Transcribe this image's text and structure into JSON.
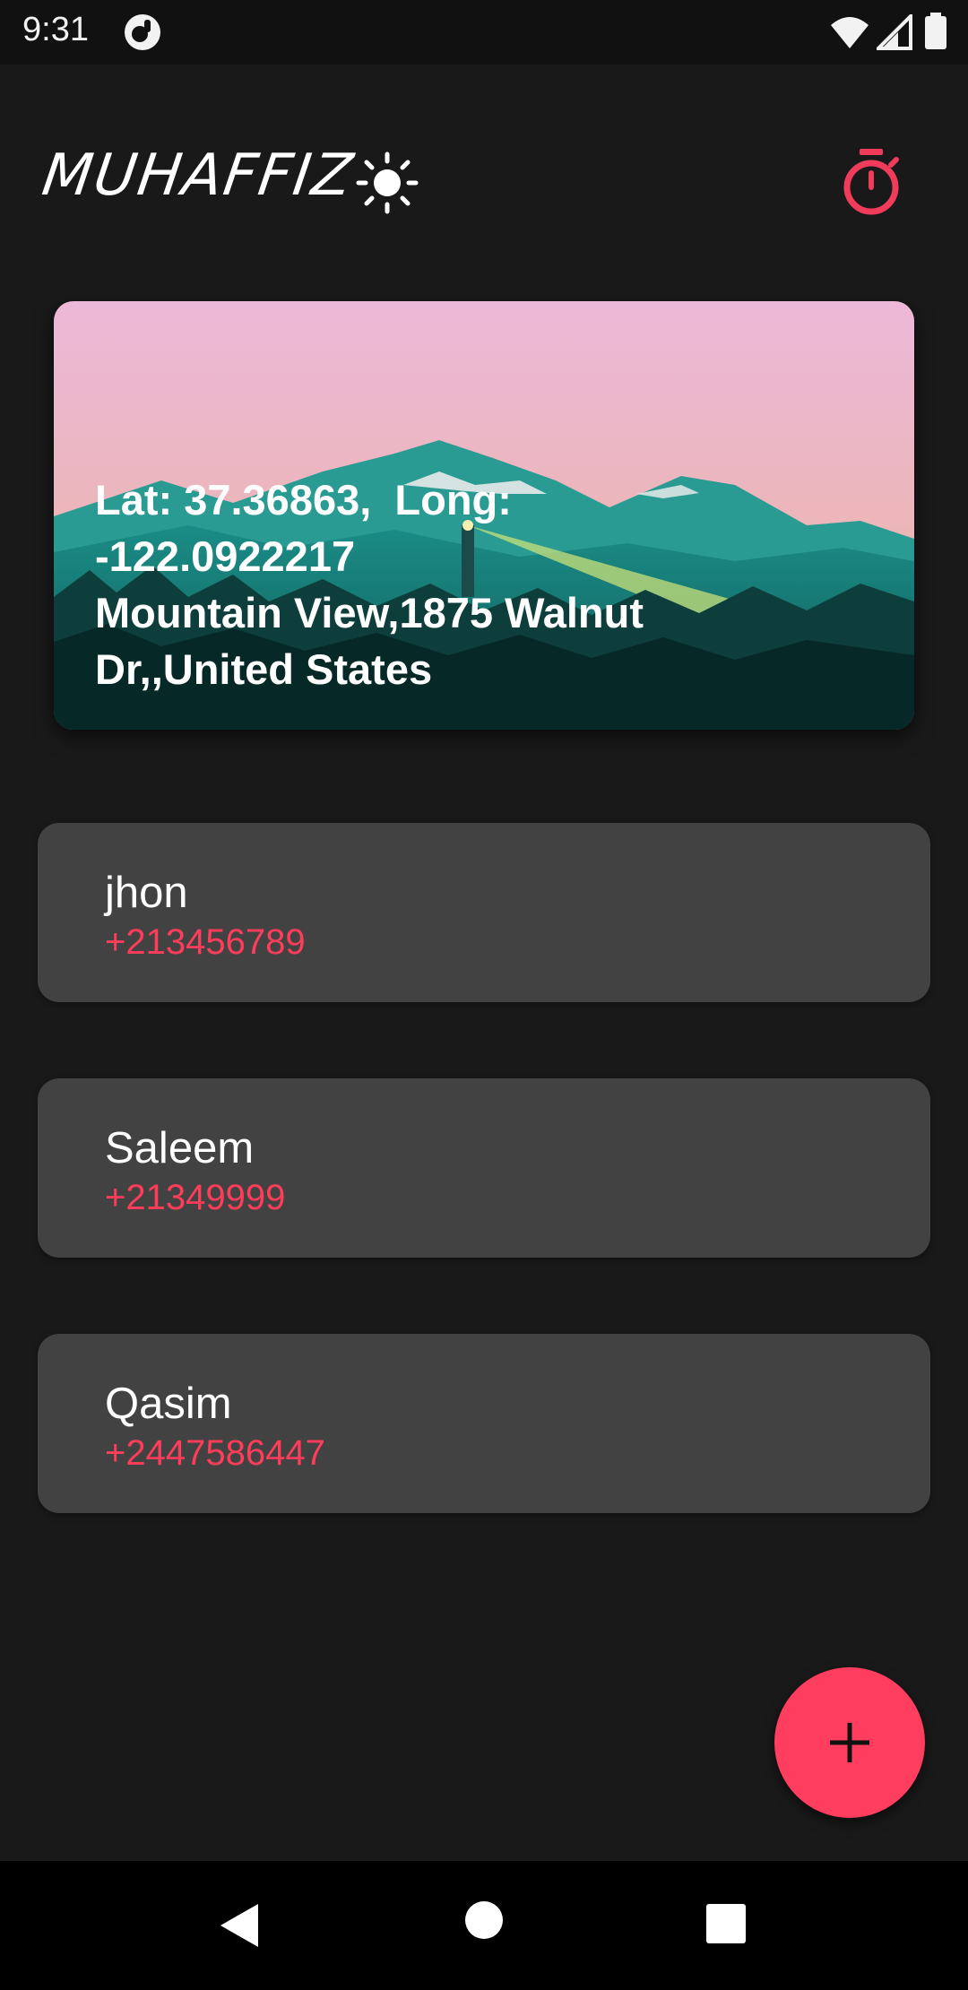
{
  "status_bar": {
    "time": "9:31",
    "icons": [
      "app-notification-icon",
      "wifi-icon",
      "cellular-signal-icon",
      "battery-icon"
    ]
  },
  "header": {
    "app_title": "MUHAFFIZ",
    "theme_toggle_icon": "sun-icon",
    "timer_icon": "stopwatch-icon"
  },
  "location_card": {
    "line1": "Lat: 37.36863,  Long:",
    "line2": "-122.0922217",
    "line3": "Mountain View,1875 Walnut",
    "line4": "Dr,,United States"
  },
  "contacts": [
    {
      "name": "jhon",
      "phone": "+213456789"
    },
    {
      "name": "Saleem",
      "phone": "+21349999"
    },
    {
      "name": "Qasim",
      "phone": "+2447586447"
    }
  ],
  "fab": {
    "icon": "plus-icon"
  },
  "nav_bar": {
    "icons": [
      "back-icon",
      "home-icon",
      "recents-icon"
    ]
  },
  "colors": {
    "background": "#191919",
    "card": "#424242",
    "accent": "#ff3d5a",
    "fab": "#ff3d5e",
    "timer_icon": "#f03c5a"
  }
}
